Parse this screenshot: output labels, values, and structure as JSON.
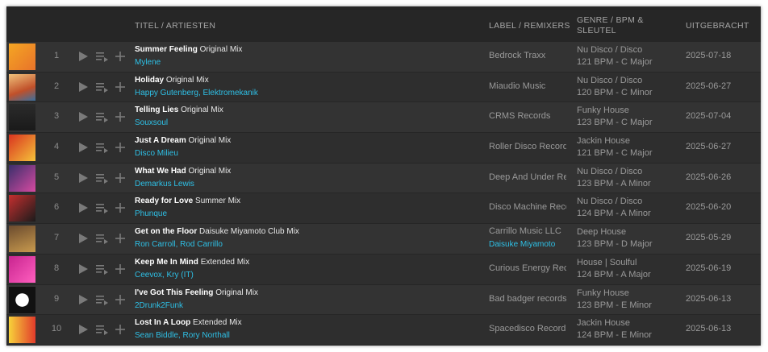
{
  "header": {
    "title_artists": "TITEL / ARTIESTEN",
    "label_remixers": "LABEL / REMIXERS",
    "genre_bpm_key": "GENRE / BPM & SLEUTEL",
    "released": "UITGEBRACHT"
  },
  "colors": {
    "background": "#262626",
    "row": "#333333",
    "accent": "#2ec0e6"
  },
  "tracks": [
    {
      "num": "1",
      "title": "Summer Feeling",
      "mix": "Original Mix",
      "artists": "Mylene",
      "label": "Bedrock Traxx",
      "remixers": "",
      "genre": "Nu Disco / Disco",
      "bpm_key": "121 BPM - C Major",
      "date": "2025-07-18"
    },
    {
      "num": "2",
      "title": "Holiday",
      "mix": "Original Mix",
      "artists": "Happy Gutenberg, Elektromekanik",
      "label": "Miaudio Music",
      "remixers": "",
      "genre": "Nu Disco / Disco",
      "bpm_key": "120 BPM - C Minor",
      "date": "2025-06-27"
    },
    {
      "num": "3",
      "title": "Telling Lies",
      "mix": "Original Mix",
      "artists": "Souxsoul",
      "label": "CRMS Records",
      "remixers": "",
      "genre": "Funky House",
      "bpm_key": "123 BPM - C Major",
      "date": "2025-07-04"
    },
    {
      "num": "4",
      "title": "Just A Dream",
      "mix": "Original Mix",
      "artists": "Disco Milieu",
      "label": "Roller Disco Record",
      "remixers": "",
      "genre": "Jackin House",
      "bpm_key": "121 BPM - C Major",
      "date": "2025-06-27"
    },
    {
      "num": "5",
      "title": "What We Had",
      "mix": "Original Mix",
      "artists": "Demarkus Lewis",
      "label": "Deep And Under Re",
      "remixers": "",
      "genre": "Nu Disco / Disco",
      "bpm_key": "123 BPM - A Minor",
      "date": "2025-06-26"
    },
    {
      "num": "6",
      "title": "Ready for Love",
      "mix": "Summer Mix",
      "artists": "Phunque",
      "label": "Disco Machine Reco",
      "remixers": "",
      "genre": "Nu Disco / Disco",
      "bpm_key": "124 BPM - A Minor",
      "date": "2025-06-20"
    },
    {
      "num": "7",
      "title": "Get on the Floor",
      "mix": "Daisuke Miyamoto Club Mix",
      "artists": "Ron Carroll, Rod Carrillo",
      "label": "Carrillo Music LLC",
      "remixers": "Daisuke Miyamoto",
      "genre": "Deep House",
      "bpm_key": "123 BPM - D Major",
      "date": "2025-05-29"
    },
    {
      "num": "8",
      "title": "Keep Me In Mind",
      "mix": "Extended Mix",
      "artists": "Ceevox, Kry (IT)",
      "label": "Curious Energy Rec",
      "remixers": "",
      "genre": "House | Soulful",
      "bpm_key": "124 BPM - A Major",
      "date": "2025-06-19"
    },
    {
      "num": "9",
      "title": "I've Got This Feeling",
      "mix": "Original Mix",
      "artists": "2Drunk2Funk",
      "label": "Bad badger records",
      "remixers": "",
      "genre": "Funky House",
      "bpm_key": "123 BPM - E Minor",
      "date": "2025-06-13"
    },
    {
      "num": "10",
      "title": "Lost In A Loop",
      "mix": "Extended Mix",
      "artists": "Sean Biddle, Rory Northall",
      "label": "Spacedisco Record",
      "remixers": "",
      "genre": "Jackin House",
      "bpm_key": "124 BPM - E Minor",
      "date": "2025-06-13"
    }
  ]
}
